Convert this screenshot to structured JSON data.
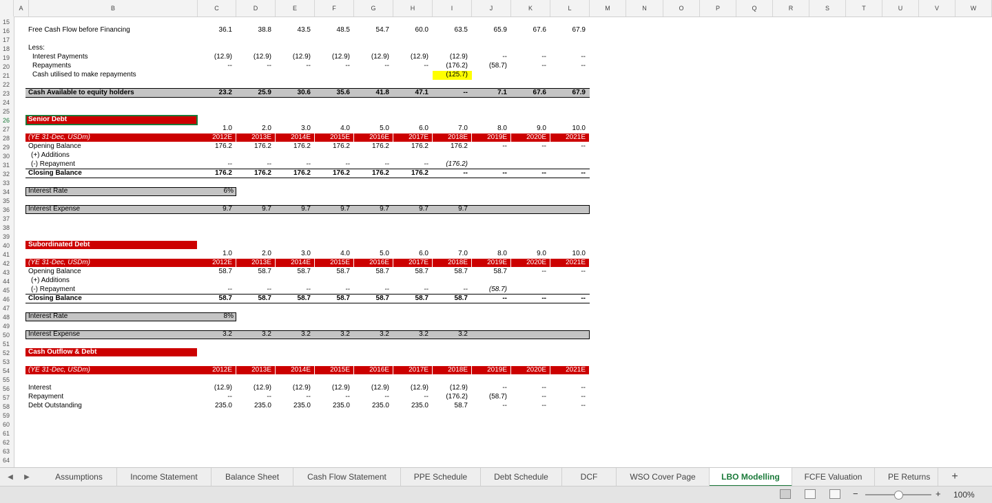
{
  "columns": [
    "A",
    "B",
    "C",
    "D",
    "E",
    "F",
    "G",
    "H",
    "I",
    "J",
    "K",
    "L",
    "M",
    "N",
    "O",
    "P",
    "Q",
    "R",
    "S",
    "T",
    "U",
    "V",
    "W"
  ],
  "rows": [
    "15",
    "16",
    "17",
    "18",
    "19",
    "20",
    "21",
    "22",
    "23",
    "24",
    "25",
    "26",
    "27",
    "28",
    "29",
    "30",
    "31",
    "32",
    "33",
    "34",
    "35",
    "36",
    "37",
    "38",
    "39",
    "40",
    "41",
    "42",
    "43",
    "44",
    "45",
    "46",
    "47",
    "48",
    "49",
    "50",
    "51",
    "52",
    "53",
    "54",
    "55",
    "56",
    "57",
    "58",
    "59",
    "60",
    "61",
    "62",
    "63",
    "64"
  ],
  "selected_row": "26",
  "fcf": {
    "label": "Free Cash Flow before Financing",
    "values": [
      "36.1",
      "38.8",
      "43.5",
      "48.5",
      "54.7",
      "60.0",
      "63.5",
      "65.9",
      "67.6",
      "67.9"
    ]
  },
  "less": {
    "label": "Less:"
  },
  "interest_payments": {
    "label": "Interest Payments",
    "values": [
      "(12.9)",
      "(12.9)",
      "(12.9)",
      "(12.9)",
      "(12.9)",
      "(12.9)",
      "(12.9)",
      "--",
      "--",
      "--"
    ]
  },
  "repayments": {
    "label": "Repayments",
    "values": [
      "--",
      "--",
      "--",
      "--",
      "--",
      "--",
      "(176.2)",
      "(58.7)",
      "--",
      "--"
    ]
  },
  "cash_utilised": {
    "label": "Cash utilised to make repayments",
    "value": "(125.7)"
  },
  "cash_available": {
    "label": "Cash Available to equity holders",
    "values": [
      "23.2",
      "25.9",
      "30.6",
      "35.6",
      "41.8",
      "47.1",
      "--",
      "7.1",
      "67.6",
      "67.9"
    ]
  },
  "senior": {
    "title": "Senior Debt",
    "periods": [
      "1.0",
      "2.0",
      "3.0",
      "4.0",
      "5.0",
      "6.0",
      "7.0",
      "8.0",
      "9.0",
      "10.0"
    ],
    "header_label": "(YE 31-Dec, USDm)",
    "years": [
      "2012E",
      "2013E",
      "2014E",
      "2015E",
      "2016E",
      "2017E",
      "2018E",
      "2019E",
      "2020E",
      "2021E"
    ],
    "opening": {
      "label": "Opening Balance",
      "values": [
        "176.2",
        "176.2",
        "176.2",
        "176.2",
        "176.2",
        "176.2",
        "176.2",
        "--",
        "--",
        "--"
      ]
    },
    "additions": {
      "label": "(+) Additions"
    },
    "repayment": {
      "label": "(-) Repayment",
      "values": [
        "--",
        "--",
        "--",
        "--",
        "--",
        "--",
        "(176.2)",
        "",
        "",
        ""
      ]
    },
    "closing": {
      "label": "Closing Balance",
      "values": [
        "176.2",
        "176.2",
        "176.2",
        "176.2",
        "176.2",
        "176.2",
        "--",
        "--",
        "--",
        "--"
      ]
    },
    "rate_label": "Interest Rate",
    "rate": "6%",
    "expense_label": "Interest Expense",
    "expense": [
      "9.7",
      "9.7",
      "9.7",
      "9.7",
      "9.7",
      "9.7",
      "9.7"
    ]
  },
  "sub": {
    "title": "Subordinated Debt",
    "periods": [
      "1.0",
      "2.0",
      "3.0",
      "4.0",
      "5.0",
      "6.0",
      "7.0",
      "8.0",
      "9.0",
      "10.0"
    ],
    "header_label": "(YE 31-Dec, USDm)",
    "years": [
      "2012E",
      "2013E",
      "2014E",
      "2015E",
      "2016E",
      "2017E",
      "2018E",
      "2019E",
      "2020E",
      "2021E"
    ],
    "opening": {
      "label": "Opening Balance",
      "values": [
        "58.7",
        "58.7",
        "58.7",
        "58.7",
        "58.7",
        "58.7",
        "58.7",
        "58.7",
        "--",
        "--"
      ]
    },
    "additions": {
      "label": "(+) Additions"
    },
    "repayment": {
      "label": "(-) Repayment",
      "values": [
        "--",
        "--",
        "--",
        "--",
        "--",
        "--",
        "--",
        "(58.7)",
        "",
        ""
      ]
    },
    "closing": {
      "label": "Closing Balance",
      "values": [
        "58.7",
        "58.7",
        "58.7",
        "58.7",
        "58.7",
        "58.7",
        "58.7",
        "--",
        "--",
        "--"
      ]
    },
    "rate_label": "Interest Rate",
    "rate": "8%",
    "expense_label": "Interest Expense",
    "expense": [
      "3.2",
      "3.2",
      "3.2",
      "3.2",
      "3.2",
      "3.2",
      "3.2"
    ]
  },
  "outflow": {
    "title": "Cash Outflow & Debt",
    "header_label": "(YE 31-Dec, USDm)",
    "years": [
      "2012E",
      "2013E",
      "2014E",
      "2015E",
      "2016E",
      "2017E",
      "2018E",
      "2019E",
      "2020E",
      "2021E"
    ],
    "interest": {
      "label": "Interest",
      "values": [
        "(12.9)",
        "(12.9)",
        "(12.9)",
        "(12.9)",
        "(12.9)",
        "(12.9)",
        "(12.9)",
        "--",
        "--",
        "--"
      ]
    },
    "repayment": {
      "label": "Repayment",
      "values": [
        "--",
        "--",
        "--",
        "--",
        "--",
        "--",
        "(176.2)",
        "(58.7)",
        "--",
        "--"
      ]
    },
    "debt": {
      "label": "Debt Outstanding",
      "values": [
        "235.0",
        "235.0",
        "235.0",
        "235.0",
        "235.0",
        "235.0",
        "58.7",
        "--",
        "--",
        "--"
      ]
    }
  },
  "tabs": [
    "Assumptions",
    "Income Statement",
    "Balance Sheet",
    "Cash Flow Statement",
    "PPE Schedule",
    "Debt Schedule",
    "DCF",
    "WSO Cover Page",
    "LBO Modelling",
    "FCFE Valuation",
    "PE Returns an"
  ],
  "active_tab": "LBO Modelling",
  "add_sheet": "+",
  "zoom": {
    "minus": "−",
    "plus": "+",
    "level": "100%"
  },
  "colors": {
    "red": "#cc0000",
    "gray": "#c4c4c4",
    "highlight": "#ffff00",
    "accent": "#1b7a3a"
  }
}
